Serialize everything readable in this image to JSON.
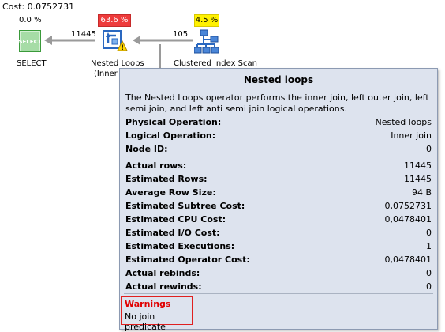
{
  "plan": {
    "cost_label": "Cost: 0.0752731"
  },
  "nodes": {
    "select": {
      "cost_pct": "0.0 %",
      "label": "SELECT"
    },
    "nested_loops": {
      "cost_pct": "63.6 %",
      "label_line1": "Nested Loops",
      "label_line2": "(Inner J"
    },
    "index_scan": {
      "cost_pct": "4.5 %",
      "label": "Clustered Index Scan"
    }
  },
  "edges": {
    "select_to_nested": "11445",
    "nested_to_scan": "105"
  },
  "colors": {
    "high_cost": "#ee3b3b",
    "medium_cost": "#fff100",
    "tooltip_bg": "#dde3ee",
    "warning_red": "#e00000"
  },
  "tooltip": {
    "title": "Nested loops",
    "description": "The Nested Loops operator performs the inner join, left outer join, left semi join, and left anti semi join logical operations.",
    "group1": [
      {
        "key": "Physical Operation:",
        "value": "Nested loops"
      },
      {
        "key": "Logical Operation:",
        "value": "Inner join"
      },
      {
        "key": "Node ID:",
        "value": "0"
      }
    ],
    "group2": [
      {
        "key": "Actual rows:",
        "value": "11445"
      },
      {
        "key": "Estimated Rows:",
        "value": "11445"
      },
      {
        "key": "Average Row Size:",
        "value": "94 B"
      },
      {
        "key": "Estimated Subtree Cost:",
        "value": "0,0752731"
      },
      {
        "key": "Estimated CPU Cost:",
        "value": "0,0478401"
      },
      {
        "key": "Estimated I/O Cost:",
        "value": "0"
      },
      {
        "key": "Estimated Executions:",
        "value": "1"
      },
      {
        "key": "Estimated Operator Cost:",
        "value": "0,0478401"
      },
      {
        "key": "Actual rebinds:",
        "value": "0"
      },
      {
        "key": "Actual rewinds:",
        "value": "0"
      }
    ],
    "warnings": {
      "title": "Warnings",
      "text": "No join predicate"
    }
  }
}
